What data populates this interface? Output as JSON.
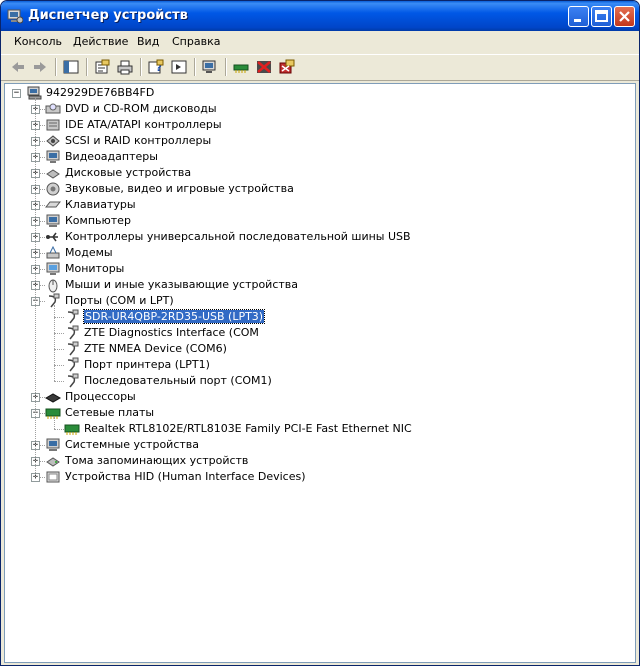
{
  "window": {
    "title": "Диспетчер устройств"
  },
  "menu": [
    "Консоль",
    "Действие",
    "Вид",
    "Справка"
  ],
  "toolbar_icons": [
    "back-icon",
    "forward-icon",
    "tree-view-icon",
    "properties-icon",
    "print-icon",
    "help-icon",
    "show-hide-icon",
    "scan-hardware-icon",
    "update-driver-icon",
    "disable-device-icon",
    "uninstall-device-icon"
  ],
  "tree": {
    "root": "942929DE76BB4FD",
    "categories": [
      {
        "label": "DVD и CD-ROM дисководы",
        "icon": "dvd-icon",
        "expanded": false
      },
      {
        "label": "IDE ATA/ATAPI контроллеры",
        "icon": "ide-controller-icon",
        "expanded": false
      },
      {
        "label": "SCSI и RAID контроллеры",
        "icon": "scsi-controller-icon",
        "expanded": false
      },
      {
        "label": "Видеоадаптеры",
        "icon": "display-adapter-icon",
        "expanded": false
      },
      {
        "label": "Дисковые устройства",
        "icon": "disk-drive-icon",
        "expanded": false
      },
      {
        "label": "Звуковые, видео и игровые устройства",
        "icon": "sound-icon",
        "expanded": false
      },
      {
        "label": "Клавиатуры",
        "icon": "keyboard-icon",
        "expanded": false
      },
      {
        "label": "Компьютер",
        "icon": "computer-icon",
        "expanded": false
      },
      {
        "label": "Контроллеры универсальной последовательной шины USB",
        "icon": "usb-icon",
        "expanded": false
      },
      {
        "label": "Модемы",
        "icon": "modem-icon",
        "expanded": false
      },
      {
        "label": "Мониторы",
        "icon": "monitor-icon",
        "expanded": false
      },
      {
        "label": "Мыши и иные указывающие устройства",
        "icon": "mouse-icon",
        "expanded": false
      },
      {
        "label": "Порты (COM и LPT)",
        "icon": "port-icon",
        "expanded": true,
        "children": [
          "SDR-UR4QBP-2RD35-USB (LPT3)",
          "ZTE Diagnostics Interface (COM",
          "ZTE NMEA Device (COM6)",
          "Порт принтера (LPT1)",
          "Последовательный порт (COM1)"
        ]
      },
      {
        "label": "Процессоры",
        "icon": "processor-icon",
        "expanded": false
      },
      {
        "label": "Сетевые платы",
        "icon": "network-adapter-icon",
        "expanded": true,
        "children": [
          "Realtek RTL8102E/RTL8103E Family PCI-E Fast Ethernet NIC"
        ]
      },
      {
        "label": "Системные устройства",
        "icon": "system-device-icon",
        "expanded": false
      },
      {
        "label": "Тома запоминающих устройств",
        "icon": "storage-volume-icon",
        "expanded": false
      },
      {
        "label": "Устройства HID (Human Interface Devices)",
        "icon": "hid-icon",
        "expanded": false
      }
    ],
    "selected": "SDR-UR4QBP-2RD35-USB (LPT3)"
  },
  "colors": {
    "titlebar": "#0058e6",
    "selection": "#316ac5",
    "window_bg": "#ece9d8"
  }
}
